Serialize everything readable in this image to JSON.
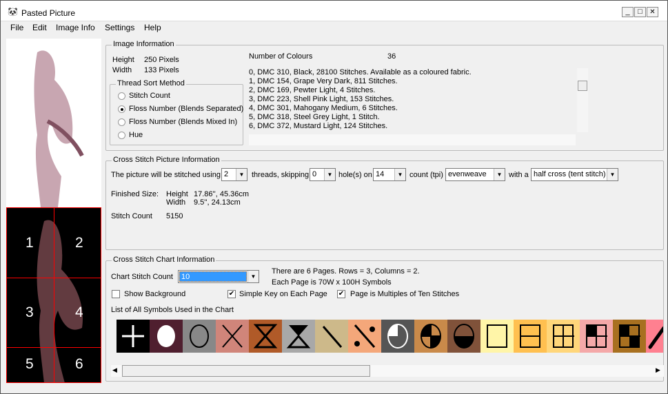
{
  "window": {
    "title": "Pasted Picture",
    "minimize": "_",
    "maximize": "□",
    "close": "✕"
  },
  "menu": [
    "File",
    "Edit",
    "Image Info",
    "Settings",
    "Help"
  ],
  "image_info": {
    "legend": "Image Information",
    "height_label": "Height",
    "height_value": "250 Pixels",
    "width_label": "Width",
    "width_value": "133 Pixels",
    "colours_label": "Number of Colours",
    "colours_value": "36",
    "sort": {
      "legend": "Thread Sort Method",
      "options": [
        "Stitch Count",
        "Floss Number (Blends Separated)",
        "Floss Number (Blends Mixed In)",
        "Hue"
      ],
      "selected": 1
    },
    "threads": [
      "0, DMC 310, Black, 28100 Stitches.  Available as a coloured fabric.",
      "1, DMC 154, Grape Very Dark, 811 Stitches.",
      "2, DMC 169, Pewter Light, 4 Stitches.",
      "3, DMC 223, Shell Pink Light, 153 Stitches.",
      "4, DMC 301, Mahogany Medium, 6 Stitches.",
      "5, DMC 318, Steel Grey Light, 1 Stitch.",
      "6, DMC 372, Mustard Light, 124 Stitches."
    ]
  },
  "picture_info": {
    "legend": "Cross Stitch Picture Information",
    "t1": "The picture will be stitched using",
    "threads": "2",
    "t2": "threads, skipping",
    "skip": "0",
    "t3": "hole(s) on",
    "count": "14",
    "t4": "count (tpi)",
    "fabric": "evenweave",
    "t5": "with a",
    "stitch": "half cross (tent stitch)",
    "finished_label": "Finished Size:",
    "height_label": "Height",
    "height_value": "17.86'',   45.36cm",
    "width_label": "Width",
    "width_value": "9.5'',   24.13cm",
    "stitch_count_label": "Stitch Count",
    "stitch_count_value": "5150"
  },
  "chart_info": {
    "legend": "Cross Stitch Chart Information",
    "chart_count_label": "Chart Stitch Count",
    "chart_count": "10",
    "pages_text": "There are 6 Pages. Rows = 3, Columns = 2.",
    "page_size_text": "Each Page is 70W x 100H Symbols",
    "show_background": {
      "label": "Show Background",
      "checked": false
    },
    "simple_key": {
      "label": "Simple Key on Each Page",
      "checked": true
    },
    "multiples": {
      "label": "Page is Multiples of Ten Stitches",
      "checked": true
    },
    "symbols_label": "List of All Symbols Used in the Chart",
    "symbols": [
      {
        "bg": "#000000",
        "s": "plus"
      },
      {
        "bg": "#4f1f2f",
        "s": "dot"
      },
      {
        "bg": "#888888",
        "s": "circle"
      },
      {
        "bg": "#d0857a",
        "s": "x"
      },
      {
        "bg": "#b05a28",
        "s": "hourglass"
      },
      {
        "bg": "#a8a8a8",
        "s": "hourglass-filled"
      },
      {
        "bg": "#cdb98a",
        "s": "backslash"
      },
      {
        "bg": "#f4a77a",
        "s": "percent"
      },
      {
        "bg": "#555555",
        "s": "pie-quarter"
      },
      {
        "bg": "#c98a4a",
        "s": "circle-quadrants"
      },
      {
        "bg": "#80523a",
        "s": "circle-half"
      },
      {
        "bg": "#fff5a8",
        "s": "square"
      },
      {
        "bg": "#ffc050",
        "s": "square-half"
      },
      {
        "bg": "#ffd67a",
        "s": "square-grid"
      },
      {
        "bg": "#f4a8a8",
        "s": "square-quarter"
      },
      {
        "bg": "#a87020",
        "s": "square-diag"
      },
      {
        "bg": "#ff8090",
        "s": "slash"
      }
    ]
  },
  "preview": {
    "page_numbers": [
      "1",
      "2",
      "3",
      "4",
      "5",
      "6"
    ],
    "grid_color": "#ff0000"
  }
}
